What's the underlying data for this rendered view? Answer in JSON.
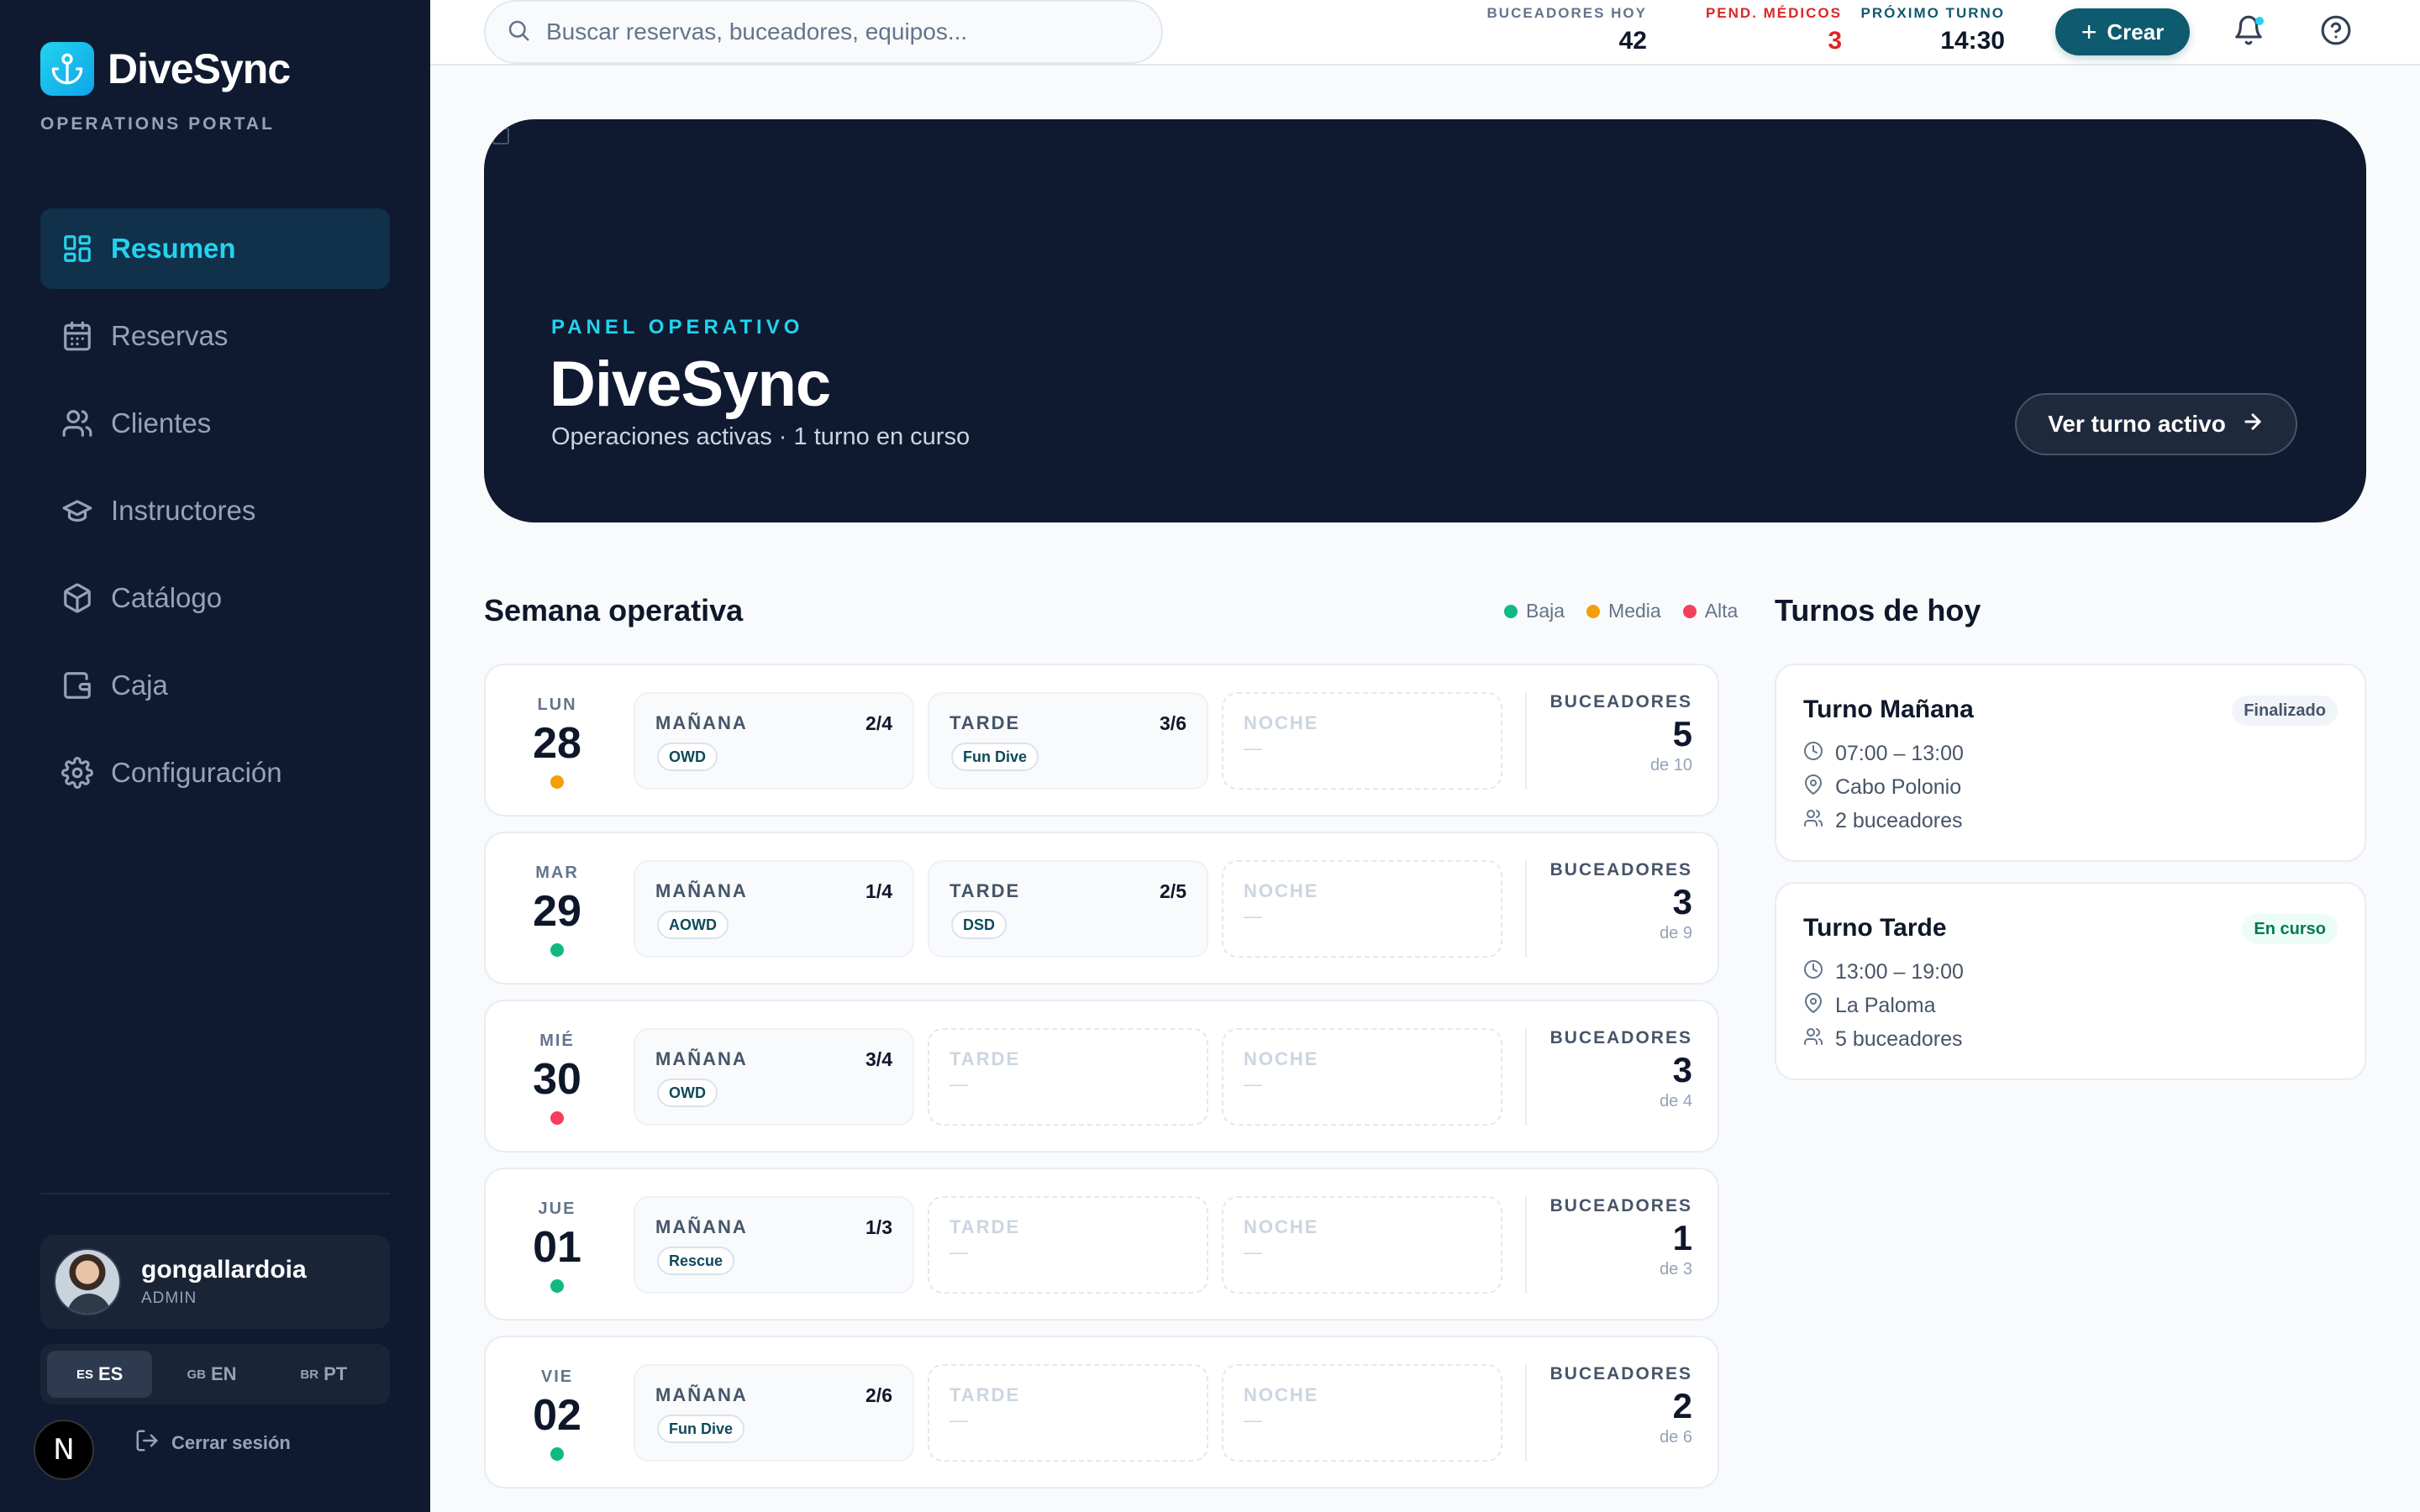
{
  "app": {
    "brand": "DiveSync",
    "subtitle": "OPERATIONS PORTAL"
  },
  "nav": [
    {
      "label": "Resumen",
      "icon": "dashboard-icon",
      "active": true
    },
    {
      "label": "Reservas",
      "icon": "calendar-icon"
    },
    {
      "label": "Clientes",
      "icon": "users-icon"
    },
    {
      "label": "Instructores",
      "icon": "graduation-cap-icon"
    },
    {
      "label": "Catálogo",
      "icon": "package-icon"
    },
    {
      "label": "Caja",
      "icon": "wallet-icon"
    },
    {
      "label": "Configuración",
      "icon": "gear-icon"
    }
  ],
  "user": {
    "name": "gongallardoia",
    "role": "ADMIN"
  },
  "languages": [
    {
      "flag": "ES",
      "code": "ES",
      "active": true
    },
    {
      "flag": "GB",
      "code": "EN"
    },
    {
      "flag": "BR",
      "code": "PT"
    }
  ],
  "n_badge": "N",
  "logout": "Cerrar sesión",
  "topbar": {
    "search_placeholder": "Buscar reservas, buceadores, equipos...",
    "stats": [
      {
        "label": "BUCEADORES HOY",
        "value": "42"
      },
      {
        "label": "PEND. MÉDICOS",
        "value": "3"
      },
      {
        "label": "PRÓXIMO TURNO",
        "value": "14:30"
      }
    ],
    "create_label": "Crear"
  },
  "hero": {
    "kicker": "PANEL OPERATIVO",
    "title": "DiveSync",
    "subtitle": "Operaciones activas · 1 turno en curso",
    "button": "Ver turno activo"
  },
  "week": {
    "title": "Semana operativa",
    "legend": [
      {
        "label": "Baja",
        "color": "#10b981"
      },
      {
        "label": "Media",
        "color": "#f59e0b"
      },
      {
        "label": "Alta",
        "color": "#f43f5e"
      }
    ],
    "divers_label": "BUCEADORES",
    "empty_dash": "—",
    "days": [
      {
        "name": "LUN",
        "num": "28",
        "level": "#f59e0b",
        "shifts": [
          {
            "name": "MAÑANA",
            "count": "2/4",
            "tag": "OWD"
          },
          {
            "name": "TARDE",
            "count": "3/6",
            "tag": "Fun Dive"
          },
          {
            "name": "NOCHE"
          }
        ],
        "divers": "5",
        "capacity": "de 10"
      },
      {
        "name": "MAR",
        "num": "29",
        "level": "#10b981",
        "shifts": [
          {
            "name": "MAÑANA",
            "count": "1/4",
            "tag": "AOWD"
          },
          {
            "name": "TARDE",
            "count": "2/5",
            "tag": "DSD"
          },
          {
            "name": "NOCHE"
          }
        ],
        "divers": "3",
        "capacity": "de 9"
      },
      {
        "name": "MIÉ",
        "num": "30",
        "level": "#f43f5e",
        "shifts": [
          {
            "name": "MAÑANA",
            "count": "3/4",
            "tag": "OWD"
          },
          {
            "name": "TARDE"
          },
          {
            "name": "NOCHE"
          }
        ],
        "divers": "3",
        "capacity": "de 4"
      },
      {
        "name": "JUE",
        "num": "01",
        "level": "#10b981",
        "shifts": [
          {
            "name": "MAÑANA",
            "count": "1/3",
            "tag": "Rescue"
          },
          {
            "name": "TARDE"
          },
          {
            "name": "NOCHE"
          }
        ],
        "divers": "1",
        "capacity": "de 3"
      },
      {
        "name": "VIE",
        "num": "02",
        "level": "#10b981",
        "shifts": [
          {
            "name": "MAÑANA",
            "count": "2/6",
            "tag": "Fun Dive"
          },
          {
            "name": "TARDE"
          },
          {
            "name": "NOCHE"
          }
        ],
        "divers": "2",
        "capacity": "de 6"
      }
    ]
  },
  "today": {
    "title": "Turnos de hoy",
    "turns": [
      {
        "title": "Turno Mañana",
        "badge": "Finalizado",
        "badge_bg": "#f1f5f9",
        "badge_color": "#475569",
        "time": "07:00 – 13:00",
        "place": "Cabo Polonio",
        "divers": "2 buceadores"
      },
      {
        "title": "Turno Tarde",
        "badge": "En curso",
        "badge_bg": "#ecfdf5",
        "badge_color": "#047857",
        "time": "13:00 – 19:00",
        "place": "La Paloma",
        "divers": "5 buceadores"
      }
    ]
  }
}
